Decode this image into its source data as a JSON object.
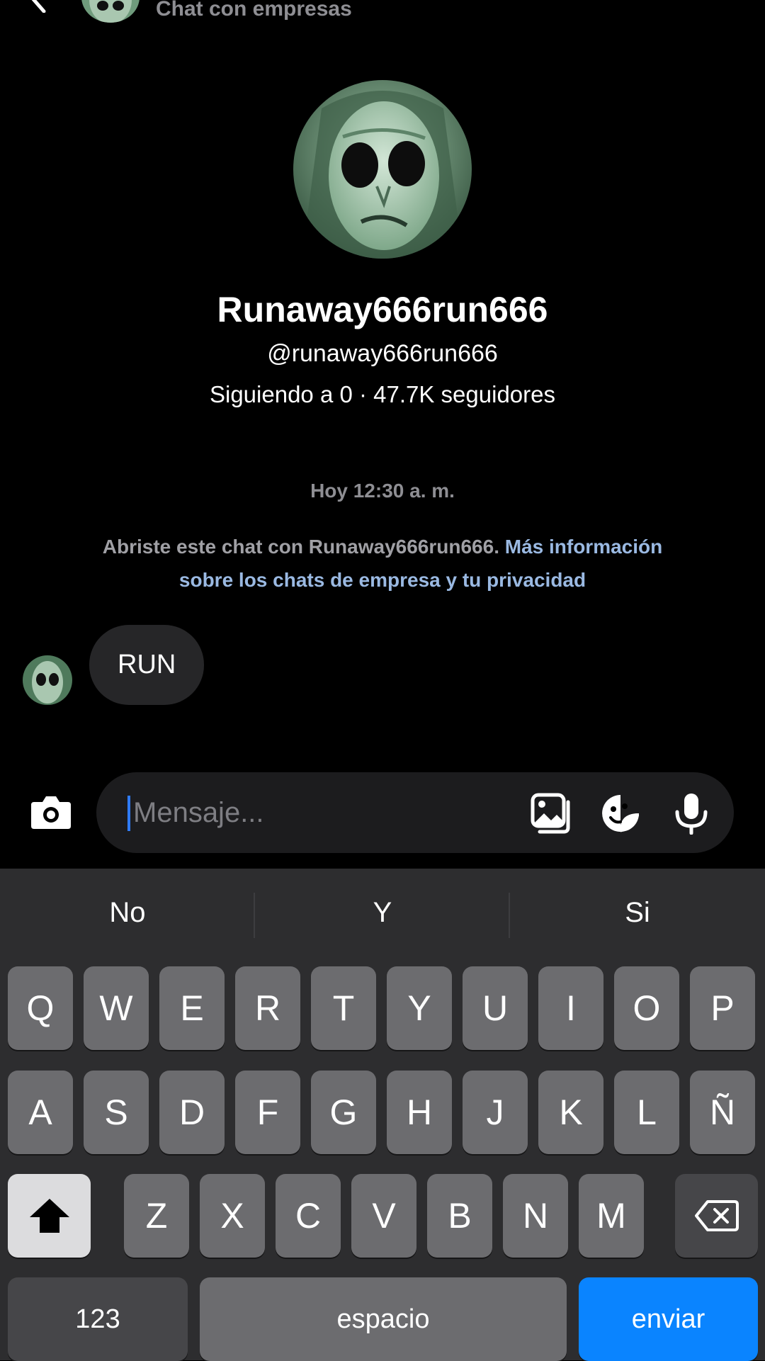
{
  "header": {
    "subtitle": "Chat con empresas"
  },
  "profile": {
    "name": "Runaway666run666",
    "handle": "@runaway666run666",
    "stats": "Siguiendo a 0 · 47.7K seguidores"
  },
  "chat": {
    "timestamp": "Hoy 12:30 a. m.",
    "info_text": "Abriste este chat con Runaway666run666.",
    "info_link": "Más información sobre los chats de empresa y tu privacidad",
    "messages": [
      {
        "text": "RUN"
      }
    ]
  },
  "composer": {
    "placeholder": "Mensaje..."
  },
  "keyboard": {
    "suggestions": [
      "No",
      "Y",
      "Si"
    ],
    "row1": [
      "Q",
      "W",
      "E",
      "R",
      "T",
      "Y",
      "U",
      "I",
      "O",
      "P"
    ],
    "row2": [
      "A",
      "S",
      "D",
      "F",
      "G",
      "H",
      "J",
      "K",
      "L",
      "Ñ"
    ],
    "row3": [
      "Z",
      "X",
      "C",
      "V",
      "B",
      "N",
      "M"
    ],
    "numbers_label": "123",
    "space_label": "espacio",
    "send_label": "enviar"
  },
  "colors": {
    "accent": "#0a84ff",
    "link": "#9ab9e2",
    "avatar_green": "#7fa88a"
  }
}
